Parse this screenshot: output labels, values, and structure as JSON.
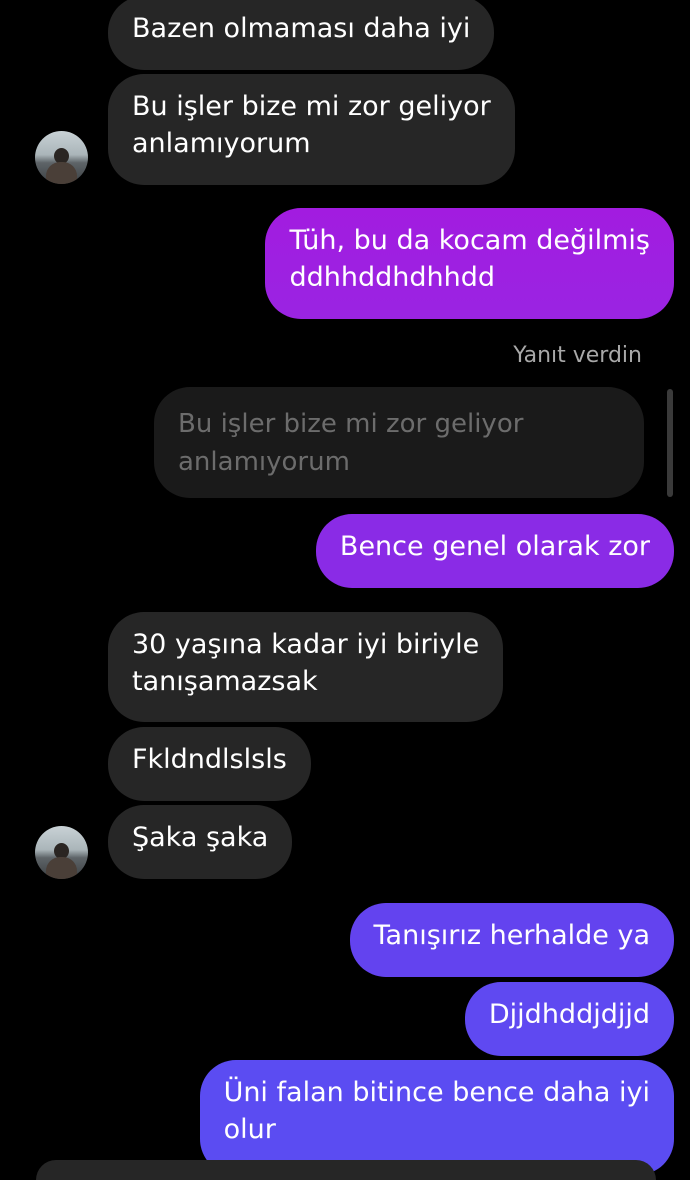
{
  "colors": {
    "background": "#000000",
    "incoming_bubble": "#262626",
    "outgoing_gradient_top": "#a21ce0",
    "outgoing_gradient_mid": "#7f30f0",
    "outgoing_gradient_bottom": "#5f4af2",
    "meta_text": "#a8a8a8"
  },
  "messages": [
    {
      "direction": "incoming",
      "text": "Bazen olmaması daha iyi"
    },
    {
      "direction": "incoming",
      "text": "Bu işler bize mi zor geliyor\nanlamıyorum",
      "avatar": "contact-avatar"
    },
    {
      "direction": "outgoing",
      "text": "Tüh, bu da kocam değilmiş\nddhhddhdhhdd"
    },
    {
      "direction": "incoming",
      "text": "30 yaşına kadar iyi biriyle\ntanışamazsak"
    },
    {
      "direction": "incoming",
      "text": "Fkldndlslsls"
    },
    {
      "direction": "incoming",
      "text": "Şaka şaka",
      "avatar": "contact-avatar"
    },
    {
      "direction": "outgoing",
      "text": "Tanışırız herhalde ya"
    },
    {
      "direction": "outgoing",
      "text": "Djjdhddjdjjd"
    },
    {
      "direction": "outgoing",
      "text": "Üni falan bitince bence daha iyi\nolur"
    }
  ],
  "reply": {
    "label": "Yanıt verdin",
    "quoted_text": "Bu işler bize mi zor geliyor\nanlamıyorum",
    "text": "Bence genel olarak zor"
  }
}
